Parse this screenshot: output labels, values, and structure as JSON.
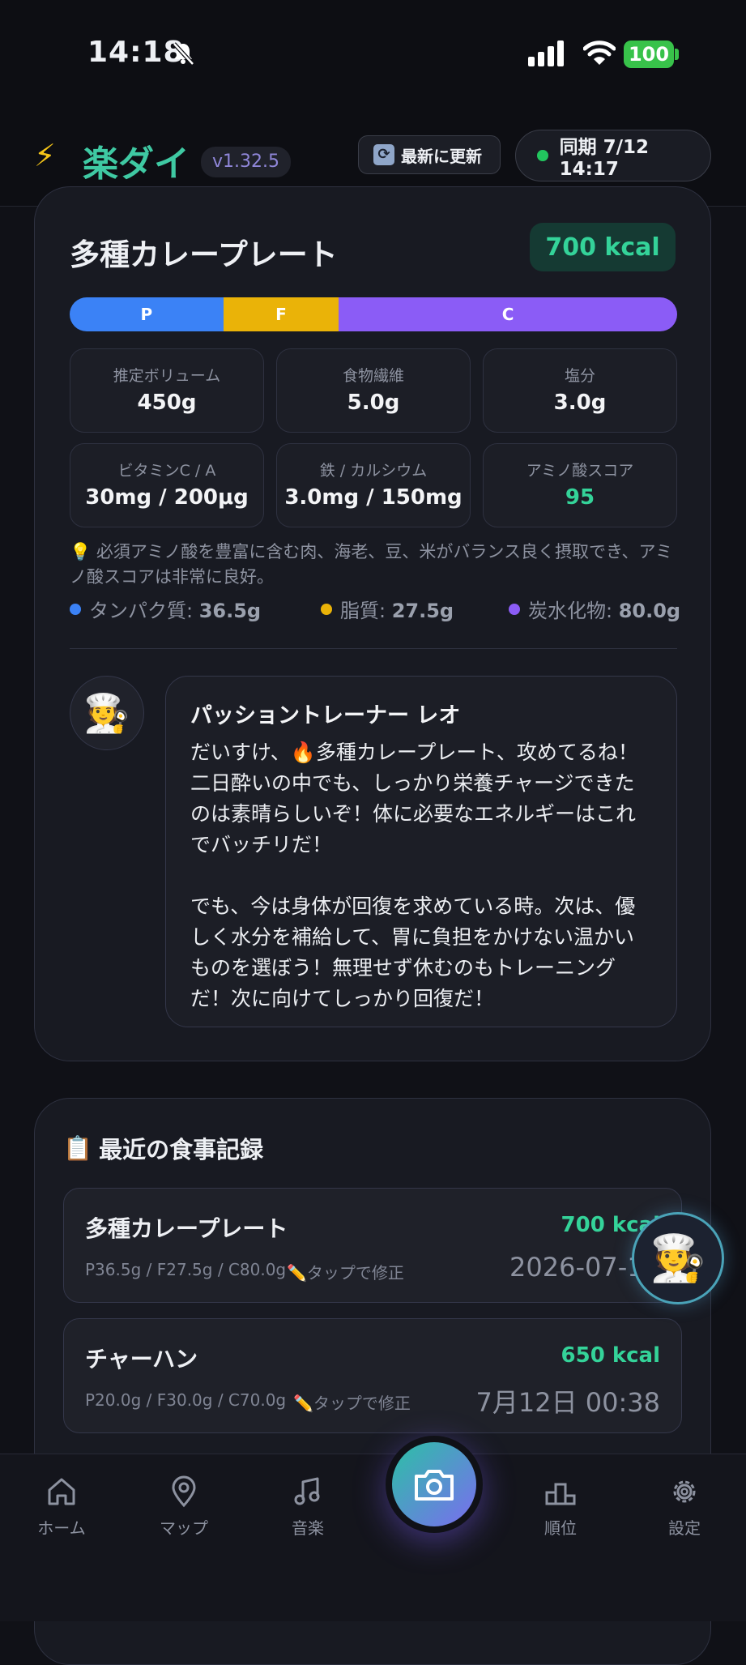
{
  "status_bar": {
    "time": "14:18",
    "battery": "100"
  },
  "header": {
    "app_title": "楽ダイ",
    "version": "v1.32.5",
    "refresh_label": "最新に更新",
    "sync_label": "同期 7/12 14:17"
  },
  "meal": {
    "title": "多種カレープレート",
    "kcal": "700 kcal",
    "pfc_bar": [
      {
        "label": "P",
        "fraction": 0.253,
        "color": "#3b82f6"
      },
      {
        "label": "F",
        "fraction": 0.19,
        "color": "#eab308"
      },
      {
        "label": "C",
        "fraction": 0.557,
        "color": "#8b5cf6"
      }
    ],
    "stats": [
      {
        "label": "推定ボリューム",
        "value": "450g"
      },
      {
        "label": "食物繊維",
        "value": "5.0g"
      },
      {
        "label": "塩分",
        "value": "3.0g"
      },
      {
        "label": "ビタミンC / A",
        "value": "30mg / 200μg"
      },
      {
        "label": "鉄 / カルシウム",
        "value": "3.0mg / 150mg"
      },
      {
        "label": "アミノ酸スコア",
        "value": "95",
        "accent": "#34d399"
      }
    ],
    "note": "💡 必須アミノ酸を豊富に含む肉、海老、豆、米がバランス良く摂取でき、アミノ酸スコアは非常に良好。",
    "macros": [
      {
        "label": "タンパク質: ",
        "value": "36.5g",
        "color": "#3b82f6"
      },
      {
        "label": "脂質: ",
        "value": "27.5g",
        "color": "#eab308"
      },
      {
        "label": "炭水化物: ",
        "value": "80.0g",
        "color": "#8b5cf6"
      }
    ]
  },
  "coach": {
    "avatar": "🧑‍🍳",
    "name": "パッショントレーナー レオ",
    "message": "だいすけ、🔥多種カレープレート、攻めてるね！二日酔いの中でも、しっかり栄養チャージできたのは素晴らしいぞ！体に必要なエネルギーはこれでバッチリだ！\n\nでも、今は身体が回復を求めている時。次は、優しく水分を補給して、胃に負担をかけない温かいものを選ぼう！無理せず休むのもトレーニングだ！次に向けてしっかり回復だ！"
  },
  "records": {
    "title_icon": "📋",
    "title": "最近の食事記録",
    "items": [
      {
        "name": "多種カレープレート",
        "kcal": "700 kcal",
        "pfc": "P36.5g / F27.5g / C80.0g",
        "edit": "✏️タップで修正",
        "date": "2026-07-12"
      },
      {
        "name": "チャーハン",
        "kcal": "650 kcal",
        "pfc": "P20.0g / F30.0g / C70.0g",
        "edit": "✏️タップで修正",
        "date": "7月12日 00:38"
      }
    ]
  },
  "fab": {
    "avatar": "🧑‍🍳"
  },
  "nav": {
    "home": "ホーム",
    "map": "マップ",
    "music": "音楽",
    "ranking": "順位",
    "settings": "設定"
  }
}
